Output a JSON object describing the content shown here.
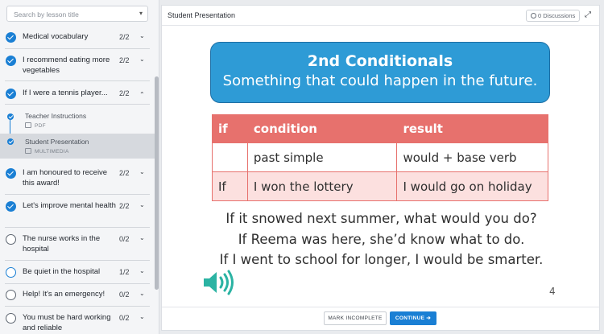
{
  "sidebar": {
    "search_placeholder": "Search by lesson title",
    "lessons": [
      {
        "title": "Medical vocabulary",
        "count": "2/2",
        "status": "done",
        "chev": "⌄"
      },
      {
        "title": "I recommend eating more vegetables",
        "count": "2/2",
        "status": "done",
        "chev": "⌄"
      },
      {
        "title": "If I were a tennis player...",
        "count": "2/2",
        "status": "done",
        "chev": "⌃"
      },
      {
        "title": "I am honoured to receive this award!",
        "count": "2/2",
        "status": "done",
        "chev": "⌄"
      },
      {
        "title": "Let's improve mental health",
        "count": "2/2",
        "status": "done",
        "chev": "⌄"
      },
      {
        "title": "The nurse works in the hospital",
        "count": "0/2",
        "status": "todo",
        "chev": "⌄"
      },
      {
        "title": "Be quiet in the hospital",
        "count": "1/2",
        "status": "partial",
        "chev": "⌄"
      },
      {
        "title": "Help! It's an emergency!",
        "count": "0/2",
        "status": "todo",
        "chev": "⌄"
      },
      {
        "title": "You must be hard working and reliable",
        "count": "0/2",
        "status": "todo",
        "chev": "⌄"
      }
    ],
    "subitems": [
      {
        "title": "Teacher Instructions",
        "type": "PDF"
      },
      {
        "title": "Student Presentation",
        "type": "MULTIMEDIA"
      }
    ]
  },
  "main": {
    "title": "Student Presentation",
    "discussions": "0 Discussions",
    "expand_icon": "⤢",
    "slide": {
      "heading": "2nd Conditionals",
      "subheading": "Something that could happen in the future.",
      "table": {
        "headers": [
          "if",
          "condition",
          "result"
        ],
        "rows": [
          [
            "",
            "past simple",
            "would + base verb"
          ],
          [
            "If",
            "I won the lottery",
            "I would go on holiday"
          ]
        ]
      },
      "examples": [
        "If it snowed next summer, what would you do?",
        "If Reema was here, she’d know what to do.",
        "If I went to school for longer, I would be smarter."
      ],
      "page_number": "4"
    },
    "buttons": {
      "mark_incomplete": "MARK INCOMPLETE",
      "continue": "CONTINUE ➔"
    }
  },
  "colors": {
    "accent": "#1a7fd4",
    "banner": "#2e9bd6",
    "table_header": "#e7716d",
    "table_row": "#fce0df",
    "speaker": "#2bb3a3"
  },
  "icons": {
    "speaker": "speaker-icon",
    "check": "check-icon"
  }
}
